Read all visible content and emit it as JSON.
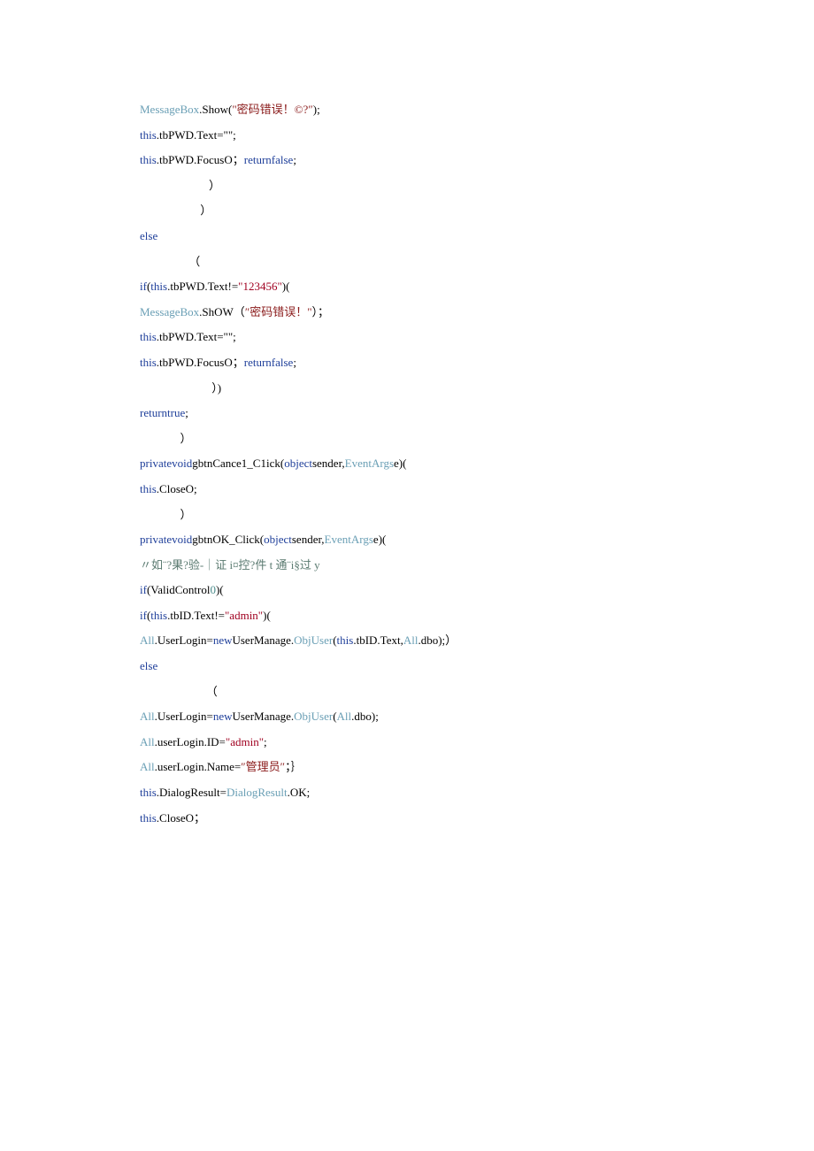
{
  "lines": [
    [
      {
        "t": "MessageBox",
        "c": "type"
      },
      {
        "t": ".Show(",
        "c": "black"
      },
      {
        "t": "\"密码错误！©?″",
        "c": "str-red2"
      },
      {
        "t": ");",
        "c": "black"
      }
    ],
    [
      {
        "t": "this",
        "c": "kw"
      },
      {
        "t": ".tbPWD.Text=\"\";",
        "c": "black"
      }
    ],
    [
      {
        "t": "this",
        "c": "kw"
      },
      {
        "t": ".tbPWD.FocusO；",
        "c": "black"
      },
      {
        "t": "returnfalse",
        "c": "kw"
      },
      {
        "t": ";",
        "c": "black"
      }
    ],
    [
      {
        "t": "                        ）",
        "c": "black"
      }
    ],
    [
      {
        "t": "                     ）",
        "c": "black"
      }
    ],
    [
      {
        "t": "else",
        "c": "kw"
      }
    ],
    [
      {
        "t": "                 （",
        "c": "black"
      }
    ],
    [
      {
        "t": "if",
        "c": "kw"
      },
      {
        "t": "(",
        "c": "black"
      },
      {
        "t": "this",
        "c": "kw"
      },
      {
        "t": ".tbPWD.Text!=",
        "c": "black"
      },
      {
        "t": "\"123456\"",
        "c": "str-red"
      },
      {
        "t": ")(",
        "c": "black"
      }
    ],
    [
      {
        "t": "MessageBox",
        "c": "type"
      },
      {
        "t": ".ShOW（",
        "c": "black"
      },
      {
        "t": "″密码错误！\"",
        "c": "str-red2"
      },
      {
        "t": "）；",
        "c": "black"
      }
    ],
    [
      {
        "t": "this",
        "c": "kw"
      },
      {
        "t": ".tbPWD.Text=\"\";",
        "c": "black"
      }
    ],
    [
      {
        "t": "this",
        "c": "kw"
      },
      {
        "t": ".tbPWD.FocusO；",
        "c": "black"
      },
      {
        "t": "returnfalse",
        "c": "kw"
      },
      {
        "t": ";",
        "c": "black"
      }
    ],
    [
      {
        "t": "                         ）)",
        "c": "black"
      }
    ],
    [
      {
        "t": "returntrue",
        "c": "kw"
      },
      {
        "t": ";",
        "c": "black"
      }
    ],
    [
      {
        "t": "              ）",
        "c": "black"
      }
    ],
    [
      {
        "t": "privatevoid",
        "c": "kw"
      },
      {
        "t": "gbtnCance1_C1ick(",
        "c": "black"
      },
      {
        "t": "object",
        "c": "kw"
      },
      {
        "t": "sender,",
        "c": "black"
      },
      {
        "t": "EventArgs",
        "c": "type"
      },
      {
        "t": "e)(",
        "c": "black"
      }
    ],
    [
      {
        "t": "this",
        "c": "kw"
      },
      {
        "t": ".CloseO;",
        "c": "black"
      }
    ],
    [
      {
        "t": "              ）",
        "c": "black"
      }
    ],
    [
      {
        "t": "privatevoid",
        "c": "kw"
      },
      {
        "t": "gbtnOK_Click(",
        "c": "black"
      },
      {
        "t": "object",
        "c": "kw"
      },
      {
        "t": "sender,",
        "c": "black"
      },
      {
        "t": "EventArgs",
        "c": "type"
      },
      {
        "t": "e)(",
        "c": "black"
      }
    ],
    [
      {
        "t": "〃如¨?果?验-｜证 i¤控?件 t 通¨i§过 y",
        "c": "greenish"
      }
    ],
    [
      {
        "t": "if",
        "c": "kw"
      },
      {
        "t": "(ValidControl",
        "c": "black"
      },
      {
        "t": "0",
        "c": "teal"
      },
      {
        "t": ")(",
        "c": "black"
      }
    ],
    [
      {
        "t": "if",
        "c": "kw"
      },
      {
        "t": "(",
        "c": "black"
      },
      {
        "t": "this",
        "c": "kw"
      },
      {
        "t": ".tbID.Text!=",
        "c": "black"
      },
      {
        "t": "\"admin\"",
        "c": "str-red"
      },
      {
        "t": ")(",
        "c": "black"
      }
    ],
    [
      {
        "t": "All",
        "c": "type"
      },
      {
        "t": ".UserLogin=",
        "c": "black"
      },
      {
        "t": "new",
        "c": "kw"
      },
      {
        "t": "UserManage.",
        "c": "black"
      },
      {
        "t": "ObjUser",
        "c": "type"
      },
      {
        "t": "(",
        "c": "black"
      },
      {
        "t": "this",
        "c": "kw"
      },
      {
        "t": ".tbID.Text,",
        "c": "black"
      },
      {
        "t": "All",
        "c": "type"
      },
      {
        "t": ".dbo);）",
        "c": "black"
      }
    ],
    [
      {
        "t": "else",
        "c": "kw"
      }
    ],
    [
      {
        "t": "                       （",
        "c": "black"
      }
    ],
    [
      {
        "t": "All",
        "c": "type"
      },
      {
        "t": ".UserLogin=",
        "c": "black"
      },
      {
        "t": "new",
        "c": "kw"
      },
      {
        "t": "UserManage.",
        "c": "black"
      },
      {
        "t": "ObjUser",
        "c": "type"
      },
      {
        "t": "(",
        "c": "black"
      },
      {
        "t": "All",
        "c": "type"
      },
      {
        "t": ".dbo);",
        "c": "black"
      }
    ],
    [
      {
        "t": "All",
        "c": "type"
      },
      {
        "t": ".userLogin.ID=",
        "c": "black"
      },
      {
        "t": "\"admin\"",
        "c": "str-red"
      },
      {
        "t": ";",
        "c": "black"
      }
    ],
    [
      {
        "t": "All",
        "c": "type"
      },
      {
        "t": ".userLogin.Name=",
        "c": "black"
      },
      {
        "t": "″管理员″",
        "c": "str-red2"
      },
      {
        "t": "；｝",
        "c": "black"
      }
    ],
    [
      {
        "t": "this",
        "c": "kw"
      },
      {
        "t": ".DialogResult=",
        "c": "black"
      },
      {
        "t": "DialogResult",
        "c": "type"
      },
      {
        "t": ".OK;",
        "c": "black"
      }
    ],
    [
      {
        "t": "this",
        "c": "kw"
      },
      {
        "t": ".CloseO；",
        "c": "black"
      }
    ]
  ]
}
